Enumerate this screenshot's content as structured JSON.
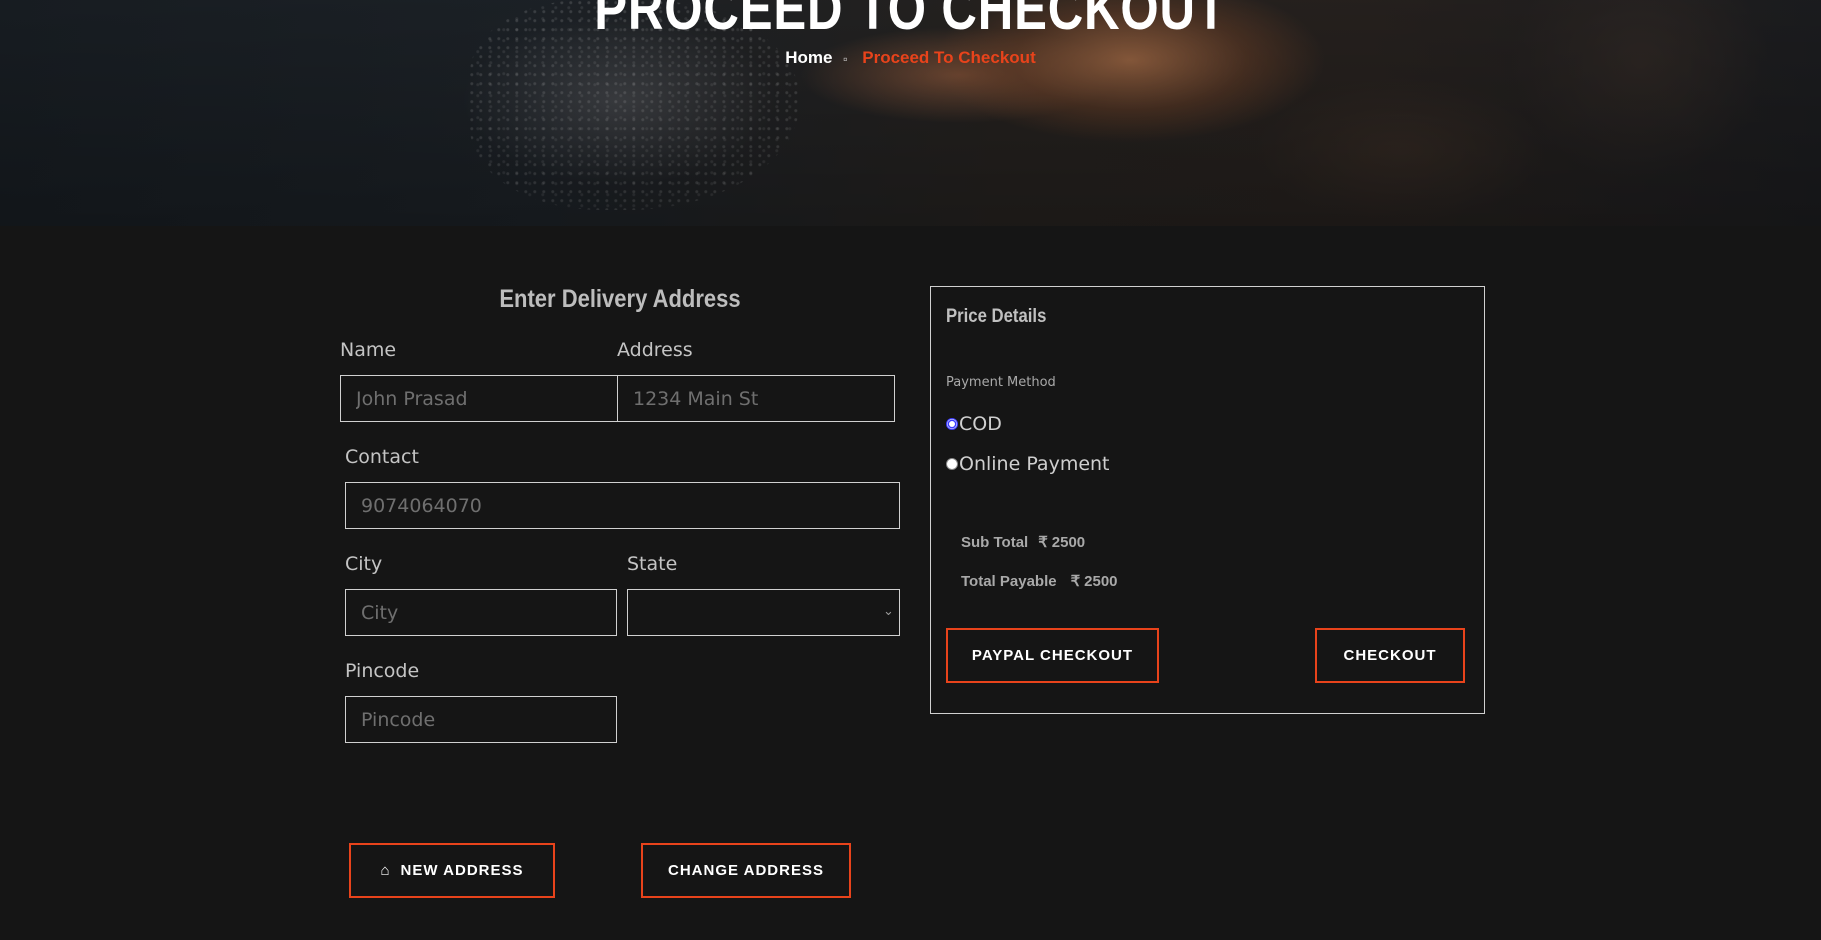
{
  "hero": {
    "title": "PROCEED TO CHECKOUT",
    "breadcrumb": {
      "home": "Home",
      "separator_icon": "chevron-right-icon",
      "current": "Proceed To Checkout"
    }
  },
  "delivery_form": {
    "title": "Enter Delivery Address",
    "name": {
      "label": "Name",
      "placeholder": "John Prasad"
    },
    "address": {
      "label": "Address",
      "placeholder": "1234 Main St"
    },
    "contact": {
      "label": "Contact",
      "placeholder": "9074064070"
    },
    "city": {
      "label": "City",
      "placeholder": "City"
    },
    "state": {
      "label": "State",
      "value": ""
    },
    "pincode": {
      "label": "Pincode",
      "placeholder": "Pincode"
    },
    "new_address_button": {
      "label": "NEW ADDRESS",
      "icon": "home-icon"
    },
    "change_address_button": {
      "label": "CHANGE ADDRESS"
    }
  },
  "price_details": {
    "title": "Price Details",
    "payment_method_label": "Payment Method",
    "payment_options": [
      {
        "label": "COD",
        "selected": true
      },
      {
        "label": "Online Payment",
        "selected": false
      }
    ],
    "sub_total": {
      "label": "Sub Total",
      "currency": "₹",
      "value": "2500"
    },
    "total_payable": {
      "label": "Total Payable",
      "currency": "₹",
      "value": "2500"
    },
    "paypal_button": "PAYPAL CHECKOUT",
    "checkout_button": "CHECKOUT"
  },
  "colors": {
    "background": "#151515",
    "accent": "#e8431b",
    "text": "#c9c9c9",
    "border": "#d0d0d0",
    "radio_selected": "#3b3bff"
  }
}
